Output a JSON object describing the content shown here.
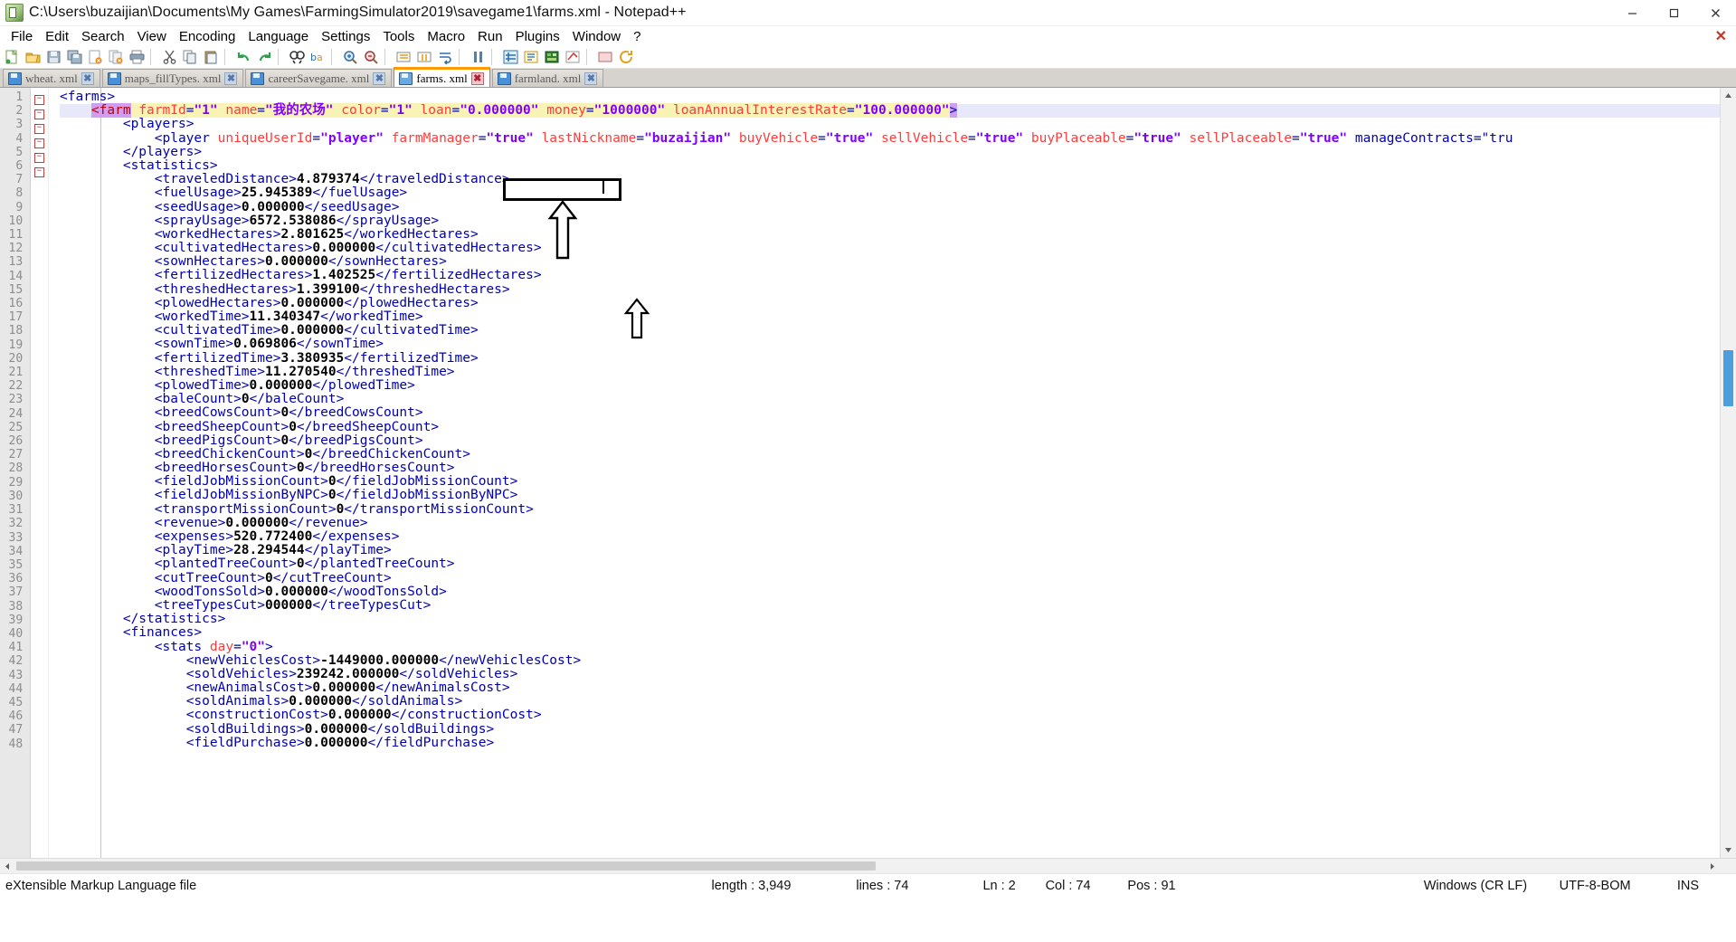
{
  "window": {
    "title": "C:\\Users\\buzaijian\\Documents\\My Games\\FarmingSimulator2019\\savegame1\\farms.xml - Notepad++",
    "app_icon": "notepadpp-icon",
    "minimize_label": "─",
    "maximize_label": "❐",
    "close_label": "✕"
  },
  "menu": {
    "items": [
      {
        "label": "File",
        "name": "menu-file"
      },
      {
        "label": "Edit",
        "name": "menu-edit"
      },
      {
        "label": "Search",
        "name": "menu-search"
      },
      {
        "label": "View",
        "name": "menu-view"
      },
      {
        "label": "Encoding",
        "name": "menu-encoding"
      },
      {
        "label": "Language",
        "name": "menu-language"
      },
      {
        "label": "Settings",
        "name": "menu-settings"
      },
      {
        "label": "Tools",
        "name": "menu-tools"
      },
      {
        "label": "Macro",
        "name": "menu-macro"
      },
      {
        "label": "Run",
        "name": "menu-run"
      },
      {
        "label": "Plugins",
        "name": "menu-plugins"
      },
      {
        "label": "Window",
        "name": "menu-window"
      },
      {
        "label": "?",
        "name": "menu-help"
      }
    ],
    "close_document_label": "✕"
  },
  "toolbar": {
    "icons": [
      "new-file-icon",
      "open-file-icon",
      "save-icon",
      "save-all-icon",
      "close-file-icon",
      "close-all-icon",
      "print-icon",
      "cut-icon",
      "copy-icon",
      "paste-icon",
      "undo-icon",
      "redo-icon",
      "find-icon",
      "replace-icon",
      "zoom-in-icon",
      "zoom-out-icon",
      "sync-vertical-scroll-icon",
      "sync-horizontal-scroll-icon",
      "word-wrap-icon",
      "show-all-characters-icon",
      "indent-guide-icon",
      "user-defined-dialog-icon",
      "show-whitespace-icon",
      "pause-icon",
      "fold-all-icon",
      "unfold-all-icon",
      "record-macro-icon",
      "stop-macro-icon",
      "playback-macro-icon",
      "run-macro-icon"
    ]
  },
  "tabs": [
    {
      "label": "wheat. xml",
      "name": "tab-wheat-xml",
      "active": false
    },
    {
      "label": "maps_fillTypes. xml",
      "name": "tab-maps-filltypes-xml",
      "active": false
    },
    {
      "label": "careerSavegame. xml",
      "name": "tab-careersavegame-xml",
      "active": false
    },
    {
      "label": "farms. xml",
      "name": "tab-farms-xml",
      "active": true
    },
    {
      "label": "farmland. xml",
      "name": "tab-farmland-xml",
      "active": false
    }
  ],
  "editor": {
    "current_line": 2,
    "first_line": 1,
    "last_line": 48,
    "annotation_box_target": "money=\"1000000\"",
    "lines": [
      {
        "n": 1,
        "indent": 0,
        "fold": "-",
        "text": "<farms>"
      },
      {
        "n": 2,
        "indent": 1,
        "fold": "-",
        "text": "<farm farmId=\"1\" name=\"我的农场\" color=\"1\" loan=\"0.000000\" money=\"1000000\" loanAnnualInterestRate=\"100.000000\">"
      },
      {
        "n": 3,
        "indent": 2,
        "fold": "-",
        "text": "<players>"
      },
      {
        "n": 4,
        "indent": 3,
        "fold": "",
        "text": "<player uniqueUserId=\"player\" farmManager=\"true\" lastNickname=\"buzaijian\" buyVehicle=\"true\" sellVehicle=\"true\" buyPlaceable=\"true\" sellPlaceable=\"true\" manageContracts=\"tru"
      },
      {
        "n": 5,
        "indent": 2,
        "fold": "",
        "text": "</players>"
      },
      {
        "n": 6,
        "indent": 2,
        "fold": "-",
        "text": "<statistics>"
      },
      {
        "n": 7,
        "indent": 3,
        "fold": "",
        "text": "<traveledDistance>4.879374</traveledDistance>"
      },
      {
        "n": 8,
        "indent": 3,
        "fold": "",
        "text": "<fuelUsage>25.945389</fuelUsage>"
      },
      {
        "n": 9,
        "indent": 3,
        "fold": "",
        "text": "<seedUsage>0.000000</seedUsage>"
      },
      {
        "n": 10,
        "indent": 3,
        "fold": "",
        "text": "<sprayUsage>6572.538086</sprayUsage>"
      },
      {
        "n": 11,
        "indent": 3,
        "fold": "",
        "text": "<workedHectares>2.801625</workedHectares>"
      },
      {
        "n": 12,
        "indent": 3,
        "fold": "",
        "text": "<cultivatedHectares>0.000000</cultivatedHectares>"
      },
      {
        "n": 13,
        "indent": 3,
        "fold": "",
        "text": "<sownHectares>0.000000</sownHectares>"
      },
      {
        "n": 14,
        "indent": 3,
        "fold": "",
        "text": "<fertilizedHectares>1.402525</fertilizedHectares>"
      },
      {
        "n": 15,
        "indent": 3,
        "fold": "",
        "text": "<threshedHectares>1.399100</threshedHectares>"
      },
      {
        "n": 16,
        "indent": 3,
        "fold": "",
        "text": "<plowedHectares>0.000000</plowedHectares>"
      },
      {
        "n": 17,
        "indent": 3,
        "fold": "",
        "text": "<workedTime>11.340347</workedTime>"
      },
      {
        "n": 18,
        "indent": 3,
        "fold": "",
        "text": "<cultivatedTime>0.000000</cultivatedTime>"
      },
      {
        "n": 19,
        "indent": 3,
        "fold": "",
        "text": "<sownTime>0.069806</sownTime>"
      },
      {
        "n": 20,
        "indent": 3,
        "fold": "",
        "text": "<fertilizedTime>3.380935</fertilizedTime>"
      },
      {
        "n": 21,
        "indent": 3,
        "fold": "",
        "text": "<threshedTime>11.270540</threshedTime>"
      },
      {
        "n": 22,
        "indent": 3,
        "fold": "",
        "text": "<plowedTime>0.000000</plowedTime>"
      },
      {
        "n": 23,
        "indent": 3,
        "fold": "",
        "text": "<baleCount>0</baleCount>"
      },
      {
        "n": 24,
        "indent": 3,
        "fold": "",
        "text": "<breedCowsCount>0</breedCowsCount>"
      },
      {
        "n": 25,
        "indent": 3,
        "fold": "",
        "text": "<breedSheepCount>0</breedSheepCount>"
      },
      {
        "n": 26,
        "indent": 3,
        "fold": "",
        "text": "<breedPigsCount>0</breedPigsCount>"
      },
      {
        "n": 27,
        "indent": 3,
        "fold": "",
        "text": "<breedChickenCount>0</breedChickenCount>"
      },
      {
        "n": 28,
        "indent": 3,
        "fold": "",
        "text": "<breedHorsesCount>0</breedHorsesCount>"
      },
      {
        "n": 29,
        "indent": 3,
        "fold": "",
        "text": "<fieldJobMissionCount>0</fieldJobMissionCount>"
      },
      {
        "n": 30,
        "indent": 3,
        "fold": "",
        "text": "<fieldJobMissionByNPC>0</fieldJobMissionByNPC>"
      },
      {
        "n": 31,
        "indent": 3,
        "fold": "",
        "text": "<transportMissionCount>0</transportMissionCount>"
      },
      {
        "n": 32,
        "indent": 3,
        "fold": "",
        "text": "<revenue>0.000000</revenue>"
      },
      {
        "n": 33,
        "indent": 3,
        "fold": "",
        "text": "<expenses>520.772400</expenses>"
      },
      {
        "n": 34,
        "indent": 3,
        "fold": "",
        "text": "<playTime>28.294544</playTime>"
      },
      {
        "n": 35,
        "indent": 3,
        "fold": "",
        "text": "<plantedTreeCount>0</plantedTreeCount>"
      },
      {
        "n": 36,
        "indent": 3,
        "fold": "",
        "text": "<cutTreeCount>0</cutTreeCount>"
      },
      {
        "n": 37,
        "indent": 3,
        "fold": "",
        "text": "<woodTonsSold>0.000000</woodTonsSold>"
      },
      {
        "n": 38,
        "indent": 3,
        "fold": "",
        "text": "<treeTypesCut>000000</treeTypesCut>"
      },
      {
        "n": 39,
        "indent": 2,
        "fold": "",
        "text": "</statistics>"
      },
      {
        "n": 40,
        "indent": 2,
        "fold": "-",
        "text": "<finances>"
      },
      {
        "n": 41,
        "indent": 3,
        "fold": "-",
        "text": "<stats day=\"0\">"
      },
      {
        "n": 42,
        "indent": 4,
        "fold": "",
        "text": "<newVehiclesCost>-1449000.000000</newVehiclesCost>"
      },
      {
        "n": 43,
        "indent": 4,
        "fold": "",
        "text": "<soldVehicles>239242.000000</soldVehicles>"
      },
      {
        "n": 44,
        "indent": 4,
        "fold": "",
        "text": "<newAnimalsCost>0.000000</newAnimalsCost>"
      },
      {
        "n": 45,
        "indent": 4,
        "fold": "",
        "text": "<soldAnimals>0.000000</soldAnimals>"
      },
      {
        "n": 46,
        "indent": 4,
        "fold": "",
        "text": "<constructionCost>0.000000</constructionCost>"
      },
      {
        "n": 47,
        "indent": 4,
        "fold": "",
        "text": "<soldBuildings>0.000000</soldBuildings>"
      },
      {
        "n": 48,
        "indent": 4,
        "fold": "",
        "text": "<fieldPurchase>0.000000</fieldPurchase>"
      }
    ]
  },
  "statusbar": {
    "file_type": "eXtensible Markup Language file",
    "length": "length : 3,949",
    "lines": "lines : 74",
    "ln": "Ln : 2",
    "col": "Col : 74",
    "pos": "Pos : 91",
    "eol": "Windows (CR LF)",
    "encoding": "UTF-8-BOM",
    "insert_mode": "INS"
  },
  "colors": {
    "tab_active_accent": "#ff9900",
    "highlight_yellow": "#faf3b6",
    "current_line": "#e8e8fb",
    "tag": "#0000b0",
    "attribute": "#ff3b3b",
    "value": "#8000ff",
    "scroll_thumb": "#4a9fdc"
  }
}
